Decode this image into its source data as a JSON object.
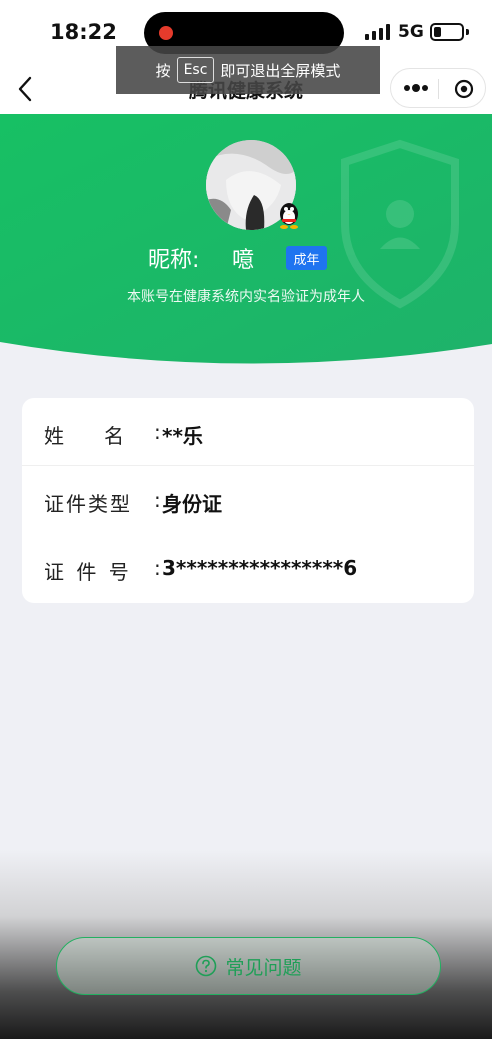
{
  "status_bar": {
    "time": "18:22",
    "network": "5G",
    "battery_level": 0.25
  },
  "nav": {
    "title": "腾讯健康系统"
  },
  "toast": {
    "prefix": "按",
    "key": "Esc",
    "suffix": "即可退出全屏模式"
  },
  "profile": {
    "nickname_label": "昵称:",
    "nickname": "噫",
    "adult_badge": "成年",
    "verify_note": "本账号在健康系统内实名验证为成年人"
  },
  "info": {
    "rows": [
      {
        "label": "姓　　名",
        "colon": ":",
        "value": "**乐"
      },
      {
        "label": "证件类型",
        "colon": ":",
        "value": "身份证"
      },
      {
        "label": "证 件 号",
        "colon": ":",
        "value": "3****************6"
      }
    ]
  },
  "faq": {
    "label": "常见问题"
  },
  "colors": {
    "brand_green": "#1fbf68",
    "badge_blue": "#1f74f0",
    "background": "#eff0f5"
  }
}
